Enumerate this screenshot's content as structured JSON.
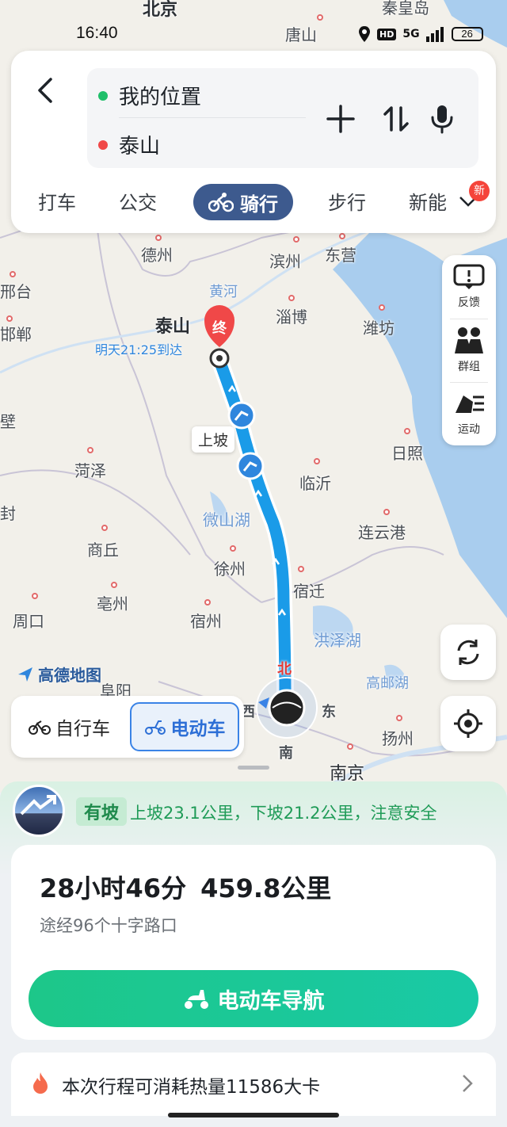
{
  "status": {
    "time": "16:40",
    "network": "5G",
    "battery": "26"
  },
  "search": {
    "origin": "我的位置",
    "destination": "泰山",
    "tabs": [
      "打车",
      "公交",
      "骑行",
      "步行",
      "新能"
    ],
    "active_tab": "骑行",
    "new_badge": "新"
  },
  "side_tools": {
    "feedback": "反馈",
    "group": "群组",
    "sport": "运动"
  },
  "map": {
    "labels": {
      "beijing": "北京",
      "tangshan": "唐山",
      "qinhuangdao": "秦皇岛",
      "dezhou": "德州",
      "binzhou": "滨州",
      "dongying": "东营",
      "huanghe": "黄河",
      "xingtai": "邢台",
      "handan": "邯郸",
      "taishan": "泰山",
      "zibo": "淄博",
      "weifang": "潍坊",
      "arrive": "明天21:25到达",
      "bi": "壁",
      "heze": "菏泽",
      "rizhao": "日照",
      "uphill": "上坡",
      "linyi": "临沂",
      "feng": "封",
      "weishanhu": "微山湖",
      "lianyungang": "连云港",
      "shangqiu": "商丘",
      "xuzhou": "徐州",
      "bozhou": "亳州",
      "suqian": "宿迁",
      "zhoukou": "周口",
      "suzhou": "宿州",
      "hongzehu": "洪泽湖",
      "fuyang": "阜阳",
      "gaoyouhu": "高邮湖",
      "dong": "东",
      "xi": "西",
      "nan": "南",
      "bei": "北",
      "yangzhou": "扬州",
      "nanjing": "南京",
      "end_marker": "终"
    },
    "logo": "高德地图"
  },
  "mode_switch": {
    "bicycle": "自行车",
    "ebike": "电动车",
    "selected": "电动车"
  },
  "route": {
    "slope_tag": "有坡",
    "slope_info": "上坡23.1公里，下坡21.2公里，注意安全",
    "duration": "28小时46分",
    "distance": "459.8公里",
    "via": "途经96个十字路口",
    "nav_button": "电动车导航",
    "calories": "本次行程可消耗热量11586大卡"
  },
  "colors": {
    "route": "#1a9be8",
    "accent": "#3a83e6",
    "primary_green": "#1dc789",
    "tab_active": "#3d5a8e",
    "badge_red": "#f5443a"
  }
}
